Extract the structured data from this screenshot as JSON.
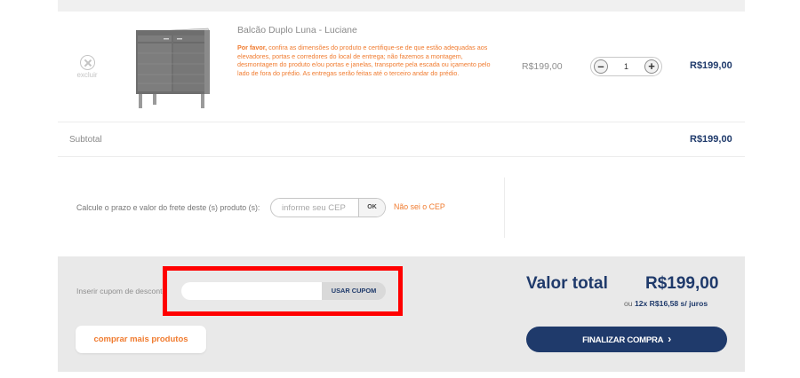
{
  "cart": {
    "item": {
      "remove_label": "excluir",
      "name": "Balcão Duplo Luna - Luciane",
      "notice_bold": "Por favor,",
      "notice_text": " confira as dimensões do produto e certifique-se de que estão adequadas aos elevadores, portas e corredores do local de entrega; não fazemos a montagem, desmontagem do produto e/ou portas e janelas, transporte pela escada ou içamento pelo lado de fora do prédio. As entregas serão feitas até o terceiro andar do prédio.",
      "unit_price": "R$199,00",
      "quantity": "1",
      "minus_label": "–",
      "plus_label": "+",
      "line_total": "R$199,00"
    },
    "subtotal": {
      "label": "Subtotal",
      "value": "R$199,00"
    },
    "freight": {
      "label": "Calcule o prazo e valor do frete deste (s) produto (s):",
      "placeholder": "informe seu CEP",
      "ok_label": "OK",
      "no_cep_link": "Não sei o CEP"
    },
    "coupon": {
      "label": "Inserir cupom de desconto",
      "placeholder": "",
      "button_label": "USAR CUPOM"
    },
    "more_products_label": "comprar mais produtos",
    "total": {
      "label": "Valor total",
      "value": "R$199,00",
      "installments_prefix": "ou ",
      "installments_value": "12x R$16,58 s/ juros"
    },
    "finish_label": "FINALIZAR COMPRA"
  },
  "colors": {
    "navy": "#1f3a6b",
    "orange": "#f07b2f",
    "panel": "#e9e9e9",
    "highlight": "#ff0000"
  },
  "icons": {
    "remove": "close-circle-icon",
    "finish": "chevron-right-icon"
  }
}
